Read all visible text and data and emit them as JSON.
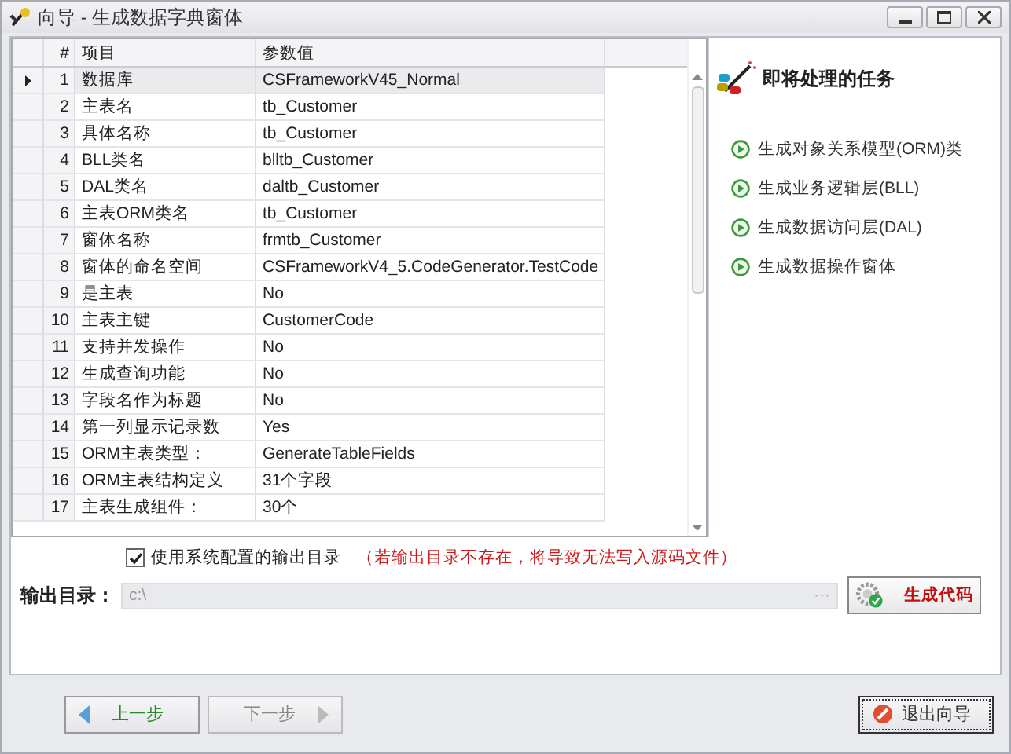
{
  "window": {
    "title": "向导 - 生成数据字典窗体"
  },
  "grid": {
    "columns": [
      "#",
      "项目",
      "参数值"
    ],
    "rows": [
      {
        "index": "1",
        "item": "数据库",
        "value": "CSFrameworkV45_Normal",
        "selected": true
      },
      {
        "index": "2",
        "item": "主表名",
        "value": "tb_Customer",
        "selected": false
      },
      {
        "index": "3",
        "item": "具体名称",
        "value": "tb_Customer",
        "selected": false
      },
      {
        "index": "4",
        "item": "BLL类名",
        "value": "blltb_Customer",
        "selected": false
      },
      {
        "index": "5",
        "item": "DAL类名",
        "value": "daltb_Customer",
        "selected": false
      },
      {
        "index": "6",
        "item": "主表ORM类名",
        "value": "tb_Customer",
        "selected": false
      },
      {
        "index": "7",
        "item": "窗体名称",
        "value": "frmtb_Customer",
        "selected": false
      },
      {
        "index": "8",
        "item": "窗体的命名空间",
        "value": "CSFrameworkV4_5.CodeGenerator.TestCode",
        "selected": false
      },
      {
        "index": "9",
        "item": "是主表",
        "value": "No",
        "selected": false
      },
      {
        "index": "10",
        "item": "主表主键",
        "value": "CustomerCode",
        "selected": false
      },
      {
        "index": "11",
        "item": "支持并发操作",
        "value": "No",
        "selected": false
      },
      {
        "index": "12",
        "item": "生成查询功能",
        "value": "No",
        "selected": false
      },
      {
        "index": "13",
        "item": "字段名作为标题",
        "value": "No",
        "selected": false
      },
      {
        "index": "14",
        "item": "第一列显示记录数",
        "value": "Yes",
        "selected": false
      },
      {
        "index": "15",
        "item": "ORM主表类型：",
        "value": "GenerateTableFields",
        "selected": false
      },
      {
        "index": "16",
        "item": "ORM主表结构定义",
        "value": "31个字段",
        "selected": false
      },
      {
        "index": "17",
        "item": "主表生成组件：",
        "value": "30个",
        "selected": false
      }
    ]
  },
  "tasks": {
    "title": "即将处理的任务",
    "items": [
      "生成对象关系模型(ORM)类",
      "生成业务逻辑层(BLL)",
      "生成数据访问层(DAL)",
      "生成数据操作窗体"
    ]
  },
  "output": {
    "use_system_config": {
      "label": "使用系统配置的输出目录",
      "checked": true
    },
    "warning": "（若输出目录不存在，将导致无法写入源码文件）",
    "label": "输出目录：",
    "path": "c:\\",
    "browse_button": "···",
    "generate_button": "生成代码"
  },
  "nav": {
    "prev": {
      "label": "上一步",
      "disabled": false
    },
    "next": {
      "label": "下一步",
      "disabled": true
    },
    "exit": "退出向导"
  }
}
